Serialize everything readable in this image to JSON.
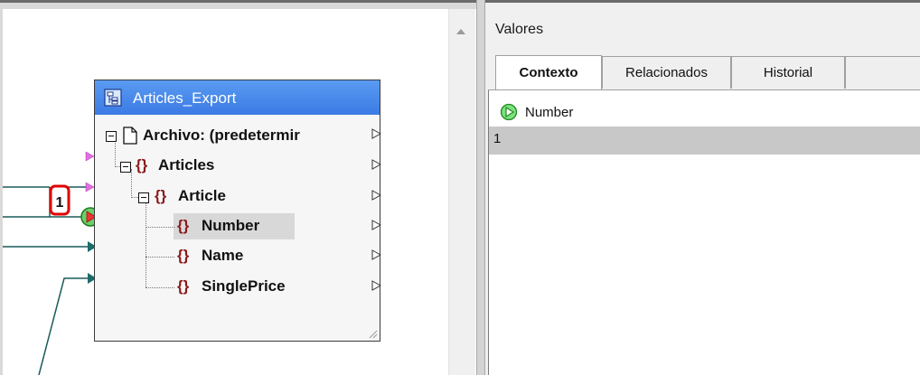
{
  "mapping": {
    "component": {
      "title": "Articles_Export",
      "root_label": "Archivo: (predetermir",
      "nodes": [
        {
          "label": "Articles"
        },
        {
          "label": "Article"
        },
        {
          "label": "Number"
        },
        {
          "label": "Name"
        },
        {
          "label": "SinglePrice"
        }
      ]
    },
    "connection_badge": "1"
  },
  "values_panel": {
    "title": "Valores",
    "tabs": [
      {
        "label": "Contexto",
        "active": true
      },
      {
        "label": "Relacionados",
        "active": false
      },
      {
        "label": "Historial",
        "active": false
      }
    ],
    "header_label": "Number",
    "rows": [
      "1"
    ]
  },
  "colors": {
    "component_header": "#3b7ae4",
    "element_brace": "#8b1a1a",
    "connection_line": "#1b5b5b",
    "badge": "#e00000",
    "play_icon": "#2aa52a"
  },
  "icons": [
    "component-icon",
    "file-icon",
    "element-icon",
    "input-port-icon",
    "output-port-icon",
    "play-icon",
    "scroll-up-icon"
  ]
}
